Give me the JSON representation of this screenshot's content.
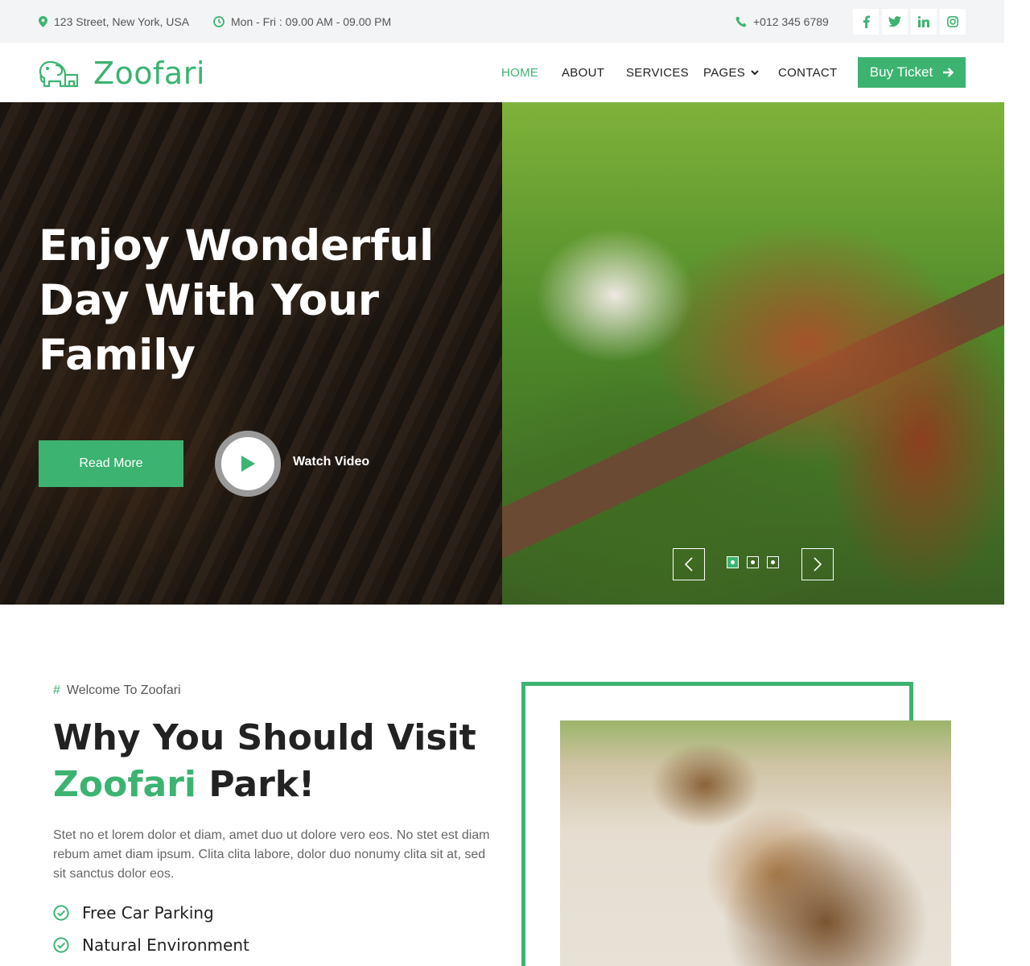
{
  "topbar": {
    "address": "123 Street, New York, USA",
    "hours": "Mon - Fri : 09.00 AM - 09.00 PM",
    "phone": "+012 345 6789",
    "social": [
      "facebook-icon",
      "twitter-icon",
      "linkedin-icon",
      "instagram-icon"
    ]
  },
  "brand": {
    "name": "Zoofari"
  },
  "nav": {
    "home": "HOME",
    "about": "ABOUT",
    "services": "SERVICES",
    "pages": "PAGES",
    "contact": "CONTACT",
    "buy_ticket": "Buy Ticket"
  },
  "hero": {
    "title": "Enjoy Wonderful Day With Your Family",
    "read_more": "Read More",
    "watch_video": "Watch Video"
  },
  "about": {
    "eyebrow_hash": "#",
    "eyebrow": "Welcome To Zoofari",
    "title_part1": "Why You Should Visit",
    "title_accent": "Zoofari",
    "title_part2": "Park!",
    "text": "Stet no et lorem dolor et diam, amet duo ut dolore vero eos. No stet est diam rebum amet diam ipsum. Clita clita labore, dolor duo nonumy clita sit at, sed sit sanctus dolor eos.",
    "features": [
      "Free Car Parking",
      "Natural Environment"
    ]
  },
  "colors": {
    "accent": "#3cb371",
    "topbar_bg": "#f3f4f5",
    "text_dark": "#222222"
  }
}
